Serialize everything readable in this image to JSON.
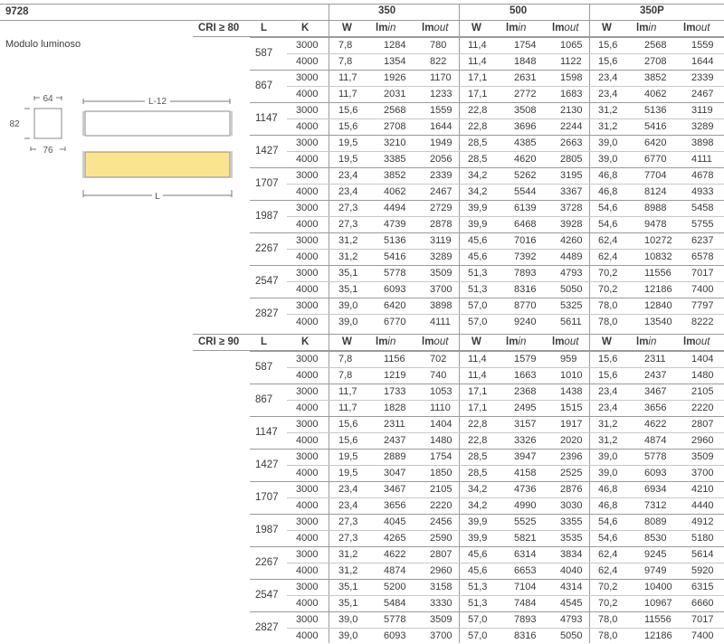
{
  "product": {
    "code": "9728",
    "description": "Modulo luminoso"
  },
  "drawing": {
    "width_label": "64",
    "height_label": "82",
    "depth_label": "76",
    "length_top_label": "L-12",
    "length_bottom_label": "L",
    "accent_color": "#fbe48f"
  },
  "header": {
    "groups": [
      "350",
      "500",
      "350P"
    ],
    "lm_prefix": "lm",
    "lm_in_suffix": "in",
    "lm_out_suffix": "out"
  },
  "sections": [
    {
      "cri_label": "CRI ≥ 80",
      "col_L": "L",
      "col_K": "K",
      "col_W": "W",
      "lengths": [
        {
          "length": "587",
          "rows": [
            {
              "k": "3000",
              "v": [
                "7,8",
                "1284",
                "780",
                "11,4",
                "1754",
                "1065",
                "15,6",
                "2568",
                "1559"
              ]
            },
            {
              "k": "4000",
              "v": [
                "7,8",
                "1354",
                "822",
                "11,4",
                "1848",
                "1122",
                "15,6",
                "2708",
                "1644"
              ]
            }
          ]
        },
        {
          "length": "867",
          "rows": [
            {
              "k": "3000",
              "v": [
                "11,7",
                "1926",
                "1170",
                "17,1",
                "2631",
                "1598",
                "23,4",
                "3852",
                "2339"
              ]
            },
            {
              "k": "4000",
              "v": [
                "11,7",
                "2031",
                "1233",
                "17,1",
                "2772",
                "1683",
                "23,4",
                "4062",
                "2467"
              ]
            }
          ]
        },
        {
          "length": "1147",
          "rows": [
            {
              "k": "3000",
              "v": [
                "15,6",
                "2568",
                "1559",
                "22,8",
                "3508",
                "2130",
                "31,2",
                "5136",
                "3119"
              ]
            },
            {
              "k": "4000",
              "v": [
                "15,6",
                "2708",
                "1644",
                "22,8",
                "3696",
                "2244",
                "31,2",
                "5416",
                "3289"
              ]
            }
          ]
        },
        {
          "length": "1427",
          "rows": [
            {
              "k": "3000",
              "v": [
                "19,5",
                "3210",
                "1949",
                "28,5",
                "4385",
                "2663",
                "39,0",
                "6420",
                "3898"
              ]
            },
            {
              "k": "4000",
              "v": [
                "19,5",
                "3385",
                "2056",
                "28,5",
                "4620",
                "2805",
                "39,0",
                "6770",
                "4111"
              ]
            }
          ]
        },
        {
          "length": "1707",
          "rows": [
            {
              "k": "3000",
              "v": [
                "23,4",
                "3852",
                "2339",
                "34,2",
                "5262",
                "3195",
                "46,8",
                "7704",
                "4678"
              ]
            },
            {
              "k": "4000",
              "v": [
                "23,4",
                "4062",
                "2467",
                "34,2",
                "5544",
                "3367",
                "46,8",
                "8124",
                "4933"
              ]
            }
          ]
        },
        {
          "length": "1987",
          "rows": [
            {
              "k": "3000",
              "v": [
                "27,3",
                "4494",
                "2729",
                "39,9",
                "6139",
                "3728",
                "54,6",
                "8988",
                "5458"
              ]
            },
            {
              "k": "4000",
              "v": [
                "27,3",
                "4739",
                "2878",
                "39,9",
                "6468",
                "3928",
                "54,6",
                "9478",
                "5755"
              ]
            }
          ]
        },
        {
          "length": "2267",
          "rows": [
            {
              "k": "3000",
              "v": [
                "31,2",
                "5136",
                "3119",
                "45,6",
                "7016",
                "4260",
                "62,4",
                "10272",
                "6237"
              ]
            },
            {
              "k": "4000",
              "v": [
                "31,2",
                "5416",
                "3289",
                "45,6",
                "7392",
                "4489",
                "62,4",
                "10832",
                "6578"
              ]
            }
          ]
        },
        {
          "length": "2547",
          "rows": [
            {
              "k": "3000",
              "v": [
                "35,1",
                "5778",
                "3509",
                "51,3",
                "7893",
                "4793",
                "70,2",
                "11556",
                "7017"
              ]
            },
            {
              "k": "4000",
              "v": [
                "35,1",
                "6093",
                "3700",
                "51,3",
                "8316",
                "5050",
                "70,2",
                "12186",
                "7400"
              ]
            }
          ]
        },
        {
          "length": "2827",
          "rows": [
            {
              "k": "3000",
              "v": [
                "39,0",
                "6420",
                "3898",
                "57,0",
                "8770",
                "5325",
                "78,0",
                "12840",
                "7797"
              ]
            },
            {
              "k": "4000",
              "v": [
                "39,0",
                "6770",
                "4111",
                "57,0",
                "9240",
                "5611",
                "78,0",
                "13540",
                "8222"
              ]
            }
          ]
        }
      ]
    },
    {
      "cri_label": "CRI ≥ 90",
      "col_L": "L",
      "col_K": "K",
      "col_W": "W",
      "lengths": [
        {
          "length": "587",
          "rows": [
            {
              "k": "3000",
              "v": [
                "7,8",
                "1156",
                "702",
                "11,4",
                "1579",
                "959",
                "15,6",
                "2311",
                "1404"
              ]
            },
            {
              "k": "4000",
              "v": [
                "7,8",
                "1219",
                "740",
                "11,4",
                "1663",
                "1010",
                "15,6",
                "2437",
                "1480"
              ]
            }
          ]
        },
        {
          "length": "867",
          "rows": [
            {
              "k": "3000",
              "v": [
                "11,7",
                "1733",
                "1053",
                "17,1",
                "2368",
                "1438",
                "23,4",
                "3467",
                "2105"
              ]
            },
            {
              "k": "4000",
              "v": [
                "11,7",
                "1828",
                "1110",
                "17,1",
                "2495",
                "1515",
                "23,4",
                "3656",
                "2220"
              ]
            }
          ]
        },
        {
          "length": "1147",
          "rows": [
            {
              "k": "3000",
              "v": [
                "15,6",
                "2311",
                "1404",
                "22,8",
                "3157",
                "1917",
                "31,2",
                "4622",
                "2807"
              ]
            },
            {
              "k": "4000",
              "v": [
                "15,6",
                "2437",
                "1480",
                "22,8",
                "3326",
                "2020",
                "31,2",
                "4874",
                "2960"
              ]
            }
          ]
        },
        {
          "length": "1427",
          "rows": [
            {
              "k": "3000",
              "v": [
                "19,5",
                "2889",
                "1754",
                "28,5",
                "3947",
                "2396",
                "39,0",
                "5778",
                "3509"
              ]
            },
            {
              "k": "4000",
              "v": [
                "19,5",
                "3047",
                "1850",
                "28,5",
                "4158",
                "2525",
                "39,0",
                "6093",
                "3700"
              ]
            }
          ]
        },
        {
          "length": "1707",
          "rows": [
            {
              "k": "3000",
              "v": [
                "23,4",
                "3467",
                "2105",
                "34,2",
                "4736",
                "2876",
                "46,8",
                "6934",
                "4210"
              ]
            },
            {
              "k": "4000",
              "v": [
                "23,4",
                "3656",
                "2220",
                "34,2",
                "4990",
                "3030",
                "46,8",
                "7312",
                "4440"
              ]
            }
          ]
        },
        {
          "length": "1987",
          "rows": [
            {
              "k": "3000",
              "v": [
                "27,3",
                "4045",
                "2456",
                "39,9",
                "5525",
                "3355",
                "54,6",
                "8089",
                "4912"
              ]
            },
            {
              "k": "4000",
              "v": [
                "27,3",
                "4265",
                "2590",
                "39,9",
                "5821",
                "3535",
                "54,6",
                "8530",
                "5180"
              ]
            }
          ]
        },
        {
          "length": "2267",
          "rows": [
            {
              "k": "3000",
              "v": [
                "31,2",
                "4622",
                "2807",
                "45,6",
                "6314",
                "3834",
                "62,4",
                "9245",
                "5614"
              ]
            },
            {
              "k": "4000",
              "v": [
                "31,2",
                "4874",
                "2960",
                "45,6",
                "6653",
                "4040",
                "62,4",
                "9749",
                "5920"
              ]
            }
          ]
        },
        {
          "length": "2547",
          "rows": [
            {
              "k": "3000",
              "v": [
                "35,1",
                "5200",
                "3158",
                "51,3",
                "7104",
                "4314",
                "70,2",
                "10400",
                "6315"
              ]
            },
            {
              "k": "4000",
              "v": [
                "35,1",
                "5484",
                "3330",
                "51,3",
                "7484",
                "4545",
                "70,2",
                "10967",
                "6660"
              ]
            }
          ]
        },
        {
          "length": "2827",
          "rows": [
            {
              "k": "3000",
              "v": [
                "39,0",
                "5778",
                "3509",
                "57,0",
                "7893",
                "4793",
                "78,0",
                "11556",
                "7017"
              ]
            },
            {
              "k": "4000",
              "v": [
                "39,0",
                "6093",
                "3700",
                "57,0",
                "8316",
                "5050",
                "78,0",
                "12186",
                "7400"
              ]
            }
          ]
        }
      ]
    }
  ]
}
